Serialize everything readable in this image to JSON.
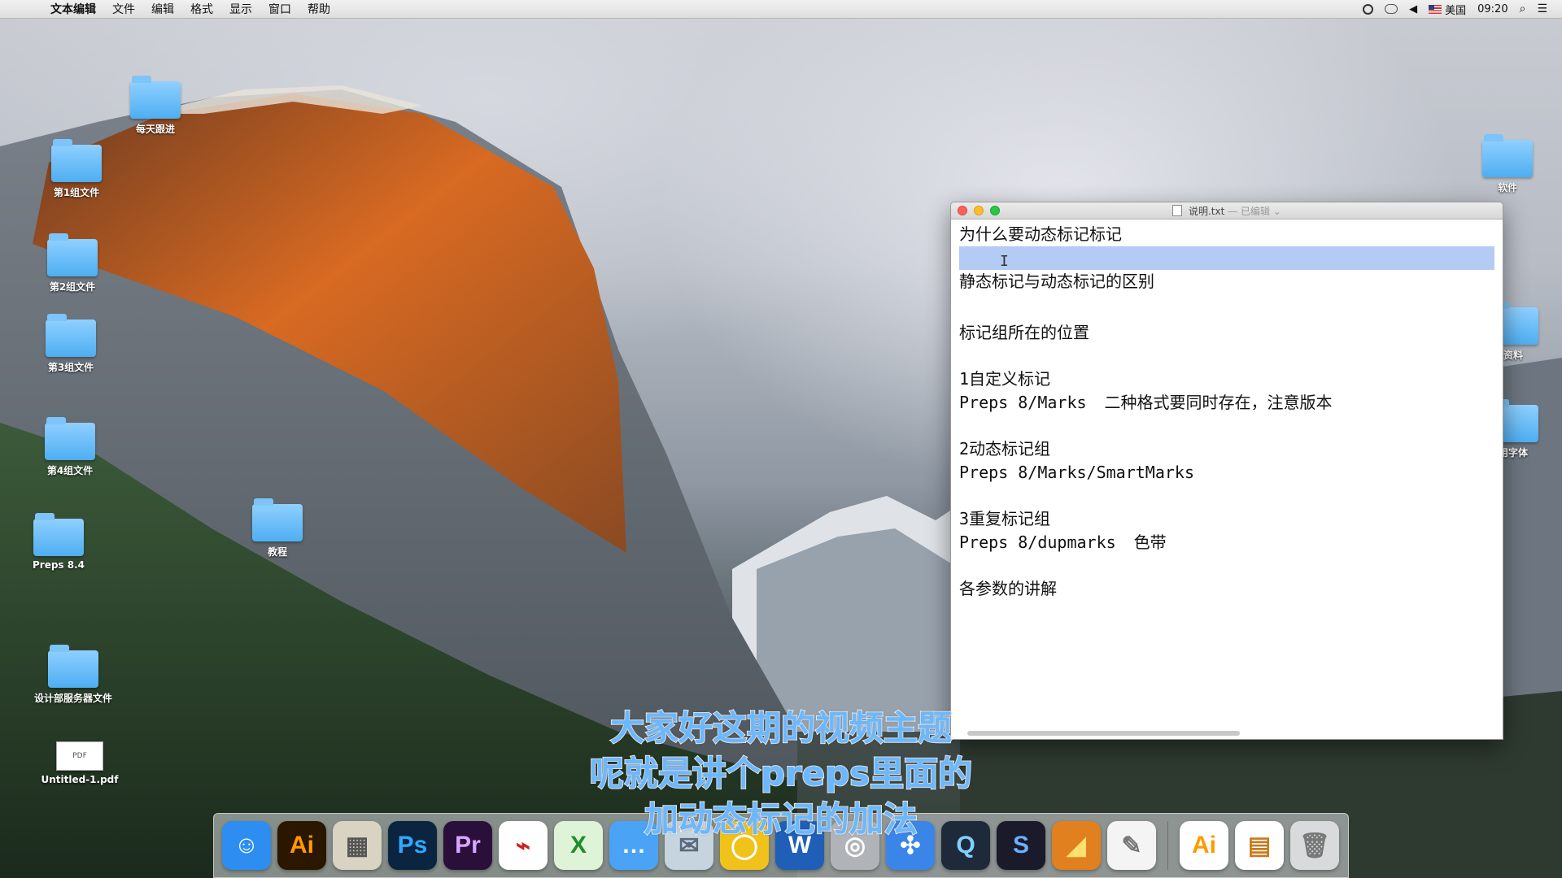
{
  "menubar": {
    "app_name": "文本编辑",
    "items": [
      "文件",
      "编辑",
      "格式",
      "显示",
      "窗口",
      "帮助"
    ],
    "input_source": "美国",
    "time": "09:20"
  },
  "desktop": {
    "left_icons": [
      {
        "label": "每天跟进",
        "type": "folder"
      },
      {
        "label": "第1组文件",
        "type": "folder"
      },
      {
        "label": "第2组文件",
        "type": "folder"
      },
      {
        "label": "第3组文件",
        "type": "folder"
      },
      {
        "label": "第4组文件",
        "type": "folder"
      },
      {
        "label": "Preps 8.4",
        "type": "folder"
      },
      {
        "label": "教程",
        "type": "folder"
      },
      {
        "label": "设计部服务器文件",
        "type": "folder"
      },
      {
        "label": "Untitled-1.pdf",
        "type": "pdf",
        "thumb_text": "PDF"
      }
    ],
    "right_icons": [
      {
        "label": "软件",
        "type": "folder"
      },
      {
        "label": "资料",
        "type": "folder"
      },
      {
        "label": "用字体",
        "type": "folder"
      }
    ]
  },
  "window": {
    "filename": "说明.txt",
    "status": "— 已编辑",
    "lines": {
      "l1": "为什么要动态标记标记",
      "l2": "",
      "l3": "静态标记与动态标记的区别",
      "l4": "标记组所在的位置",
      "l5": "1自定义标记",
      "l6": "Preps 8/Marks",
      "l6_note": "二种格式要同时存在，注意版本",
      "l7": "2动态标记组",
      "l8": "Preps 8/Marks/SmartMarks",
      "l9": "3重复标记组",
      "l10": "Preps 8/dupmarks",
      "l10_note": "色带",
      "l11": "各参数的讲解"
    }
  },
  "subtitle": {
    "line1": "大家好这期的视频主题",
    "line2": "呢就是讲个preps里面的",
    "line3": "加动态标记的加法"
  },
  "dock": {
    "apps": [
      {
        "name": "finder-icon",
        "glyph": "☺",
        "bg": "#2e8df0",
        "fg": "#ffffff"
      },
      {
        "name": "illustrator-icon",
        "glyph": "Ai",
        "bg": "#2b1600",
        "fg": "#ff9a00"
      },
      {
        "name": "calculator-icon",
        "glyph": "▦",
        "bg": "#d9d3c2",
        "fg": "#555555"
      },
      {
        "name": "photoshop-icon",
        "glyph": "Ps",
        "bg": "#0b2540",
        "fg": "#31a8ff"
      },
      {
        "name": "premiere-icon",
        "glyph": "Pr",
        "bg": "#2a0f3a",
        "fg": "#d8a6ff"
      },
      {
        "name": "acrobat-icon",
        "glyph": "⌁",
        "bg": "#ffffff",
        "fg": "#d11f1f"
      },
      {
        "name": "excel-icon",
        "glyph": "X",
        "bg": "#dff3d6",
        "fg": "#1e8f2a"
      },
      {
        "name": "messages-icon",
        "glyph": "…",
        "bg": "#4aa3f5",
        "fg": "#ffffff"
      },
      {
        "name": "mail-icon",
        "glyph": "✉",
        "bg": "#c6d4e0",
        "fg": "#5a6a7a"
      },
      {
        "name": "ring-app-icon",
        "glyph": "◯",
        "bg": "#f0c21a",
        "fg": "#ffffff"
      },
      {
        "name": "word-icon",
        "glyph": "W",
        "bg": "#1f5fb8",
        "fg": "#ffffff"
      },
      {
        "name": "launchpad-icon",
        "glyph": "◎",
        "bg": "#b0b4b8",
        "fg": "#ffffff"
      },
      {
        "name": "safari-icon",
        "glyph": "✣",
        "bg": "#3a86e8",
        "fg": "#ffffff"
      },
      {
        "name": "quicktime-icon",
        "glyph": "Q",
        "bg": "#1e2a3a",
        "fg": "#7fd0ff"
      },
      {
        "name": "sketchup-icon",
        "glyph": "S",
        "bg": "#1a1a2a",
        "fg": "#6ab0ff"
      },
      {
        "name": "flame-app-icon",
        "glyph": "◢",
        "bg": "#e0801e",
        "fg": "#ffe070"
      },
      {
        "name": "textedit-icon",
        "glyph": "✎",
        "bg": "#f4f4f4",
        "fg": "#777777"
      },
      {
        "name": "ai-document-icon",
        "glyph": "Ai",
        "bg": "#ffffff",
        "fg": "#ff9a00"
      },
      {
        "name": "image-document-icon",
        "glyph": "▤",
        "bg": "#ffffff",
        "fg": "#c87a1a"
      },
      {
        "name": "trash-icon",
        "glyph": "🗑",
        "bg": "#d8dadc",
        "fg": "#777777"
      }
    ]
  }
}
